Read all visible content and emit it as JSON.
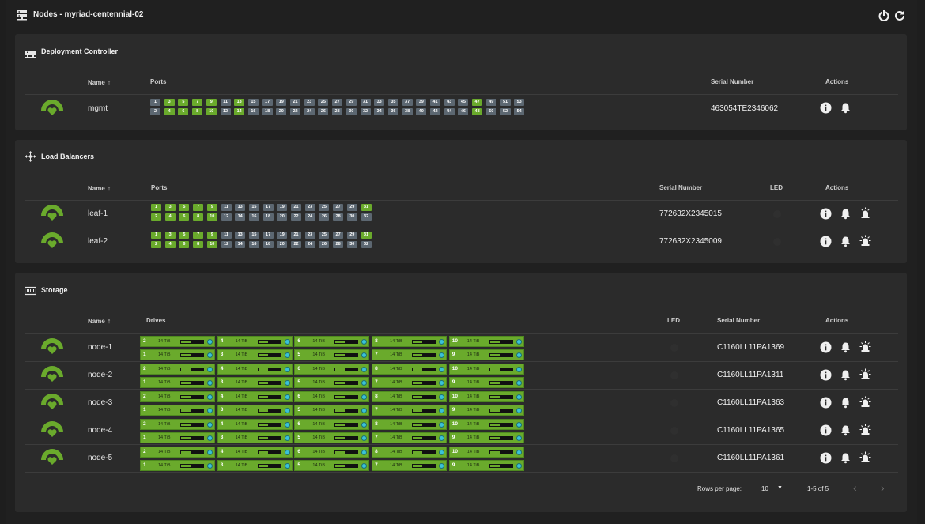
{
  "page": {
    "title": "Nodes - myriad-centennial-02",
    "icons": [
      "server-icon",
      "power-icon",
      "refresh-icon"
    ]
  },
  "colors": {
    "port_up": "#6aaa2c",
    "port_down": "#5c6771",
    "card": "#2b2b2b",
    "background": "#202020",
    "drive_status": "#3bc2d6"
  },
  "deployment_controller": {
    "title": "Deployment Controller",
    "headers": {
      "name": "Name",
      "ports": "Ports",
      "serial": "Serial Number",
      "actions": "Actions"
    },
    "rows": [
      {
        "name": "mgmt",
        "serial": "463054TE2346062",
        "ports_top": [
          "1",
          "3",
          "5",
          "7",
          "9",
          "11",
          "13",
          "15",
          "17",
          "19",
          "21",
          "23",
          "25",
          "27",
          "29",
          "31",
          "33",
          "35",
          "37",
          "39",
          "41",
          "43",
          "45",
          "47",
          "49",
          "51",
          "53"
        ],
        "ports_bottom": [
          "2",
          "4",
          "6",
          "8",
          "10",
          "12",
          "14",
          "16",
          "18",
          "20",
          "22",
          "24",
          "26",
          "28",
          "30",
          "32",
          "34",
          "36",
          "38",
          "40",
          "42",
          "44",
          "46",
          "48",
          "50",
          "52",
          "54"
        ],
        "up": [
          "3",
          "4",
          "5",
          "6",
          "7",
          "8",
          "9",
          "10",
          "13",
          "14",
          "47",
          "48"
        ]
      }
    ]
  },
  "load_balancers": {
    "title": "Load Balancers",
    "headers": {
      "name": "Name",
      "ports": "Ports",
      "serial": "Serial Number",
      "led": "LED",
      "actions": "Actions"
    },
    "rows": [
      {
        "name": "leaf-1",
        "serial": "772632X2345015",
        "ports_top": [
          "1",
          "3",
          "5",
          "7",
          "9",
          "11",
          "13",
          "15",
          "17",
          "19",
          "21",
          "23",
          "25",
          "27",
          "29",
          "31"
        ],
        "ports_bottom": [
          "2",
          "4",
          "6",
          "8",
          "10",
          "12",
          "14",
          "16",
          "18",
          "20",
          "22",
          "24",
          "26",
          "28",
          "30",
          "32"
        ],
        "up": [
          "1",
          "2",
          "3",
          "4",
          "5",
          "6",
          "7",
          "8",
          "9",
          "10",
          "31"
        ]
      },
      {
        "name": "leaf-2",
        "serial": "772632X2345009",
        "ports_top": [
          "1",
          "3",
          "5",
          "7",
          "9",
          "11",
          "13",
          "15",
          "17",
          "19",
          "21",
          "23",
          "25",
          "27",
          "29",
          "31"
        ],
        "ports_bottom": [
          "2",
          "4",
          "6",
          "8",
          "10",
          "12",
          "14",
          "16",
          "18",
          "20",
          "22",
          "24",
          "26",
          "28",
          "30",
          "32"
        ],
        "up": [
          "1",
          "2",
          "3",
          "4",
          "5",
          "6",
          "7",
          "8",
          "9",
          "10",
          "31"
        ]
      }
    ]
  },
  "storage": {
    "title": "Storage",
    "headers": {
      "name": "Name",
      "drives": "Drives",
      "led": "LED",
      "serial": "Serial Number",
      "actions": "Actions"
    },
    "drive_capacity": "14 TiB",
    "drives_top": [
      "2",
      "4",
      "6",
      "8",
      "10"
    ],
    "drives_bottom": [
      "1",
      "3",
      "5",
      "7",
      "9"
    ],
    "rows": [
      {
        "name": "node-1",
        "serial": "C1160LL11PA1369"
      },
      {
        "name": "node-2",
        "serial": "C1160LL11PA1311"
      },
      {
        "name": "node-3",
        "serial": "C1160LL11PA1363"
      },
      {
        "name": "node-4",
        "serial": "C1160LL11PA1365"
      },
      {
        "name": "node-5",
        "serial": "C1160LL11PA1361"
      }
    ],
    "pagination": {
      "rows_per_page_label": "Rows per page:",
      "rows_per_page": "10",
      "range": "1-5 of 5"
    }
  }
}
